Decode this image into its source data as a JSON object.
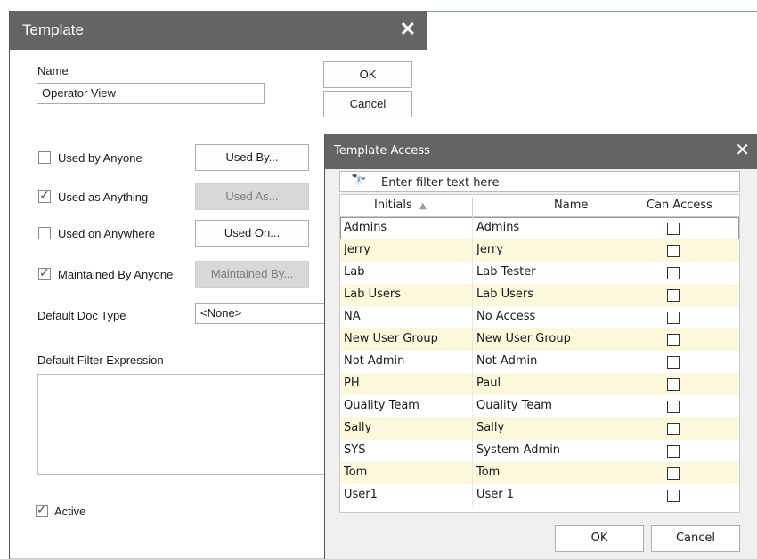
{
  "template_dialog": {
    "title": "Template",
    "name_label": "Name",
    "name_value": "Operator View",
    "ok_label": "OK",
    "cancel_label": "Cancel",
    "used_by_anyone_label": "Used by Anyone",
    "used_by_button": "Used By...",
    "used_as_anything_label": "Used as Anything",
    "used_as_button": "Used As...",
    "used_on_anywhere_label": "Used on Anywhere",
    "used_on_button": "Used On...",
    "maintained_by_anyone_label": "Maintained By Anyone",
    "maintained_by_button": "Maintained By...",
    "default_doc_type_label": "Default Doc Type",
    "default_doc_type_value": "<None>",
    "default_filter_label": "Default Filter Expression",
    "active_label": "Active"
  },
  "access_dialog": {
    "title": "Template Access",
    "filter_placeholder": "Enter filter text here",
    "columns": {
      "initials": "Initials",
      "sort_glyph": "▲",
      "name": "Name",
      "can_access": "Can Access"
    },
    "rows": [
      {
        "initials": "Admins",
        "name": "Admins"
      },
      {
        "initials": "Jerry",
        "name": "Jerry"
      },
      {
        "initials": "Lab",
        "name": "Lab Tester"
      },
      {
        "initials": "Lab Users",
        "name": "Lab Users"
      },
      {
        "initials": "NA",
        "name": "No Access"
      },
      {
        "initials": "New User Group",
        "name": "New User Group"
      },
      {
        "initials": "Not Admin",
        "name": "Not Admin"
      },
      {
        "initials": "PH",
        "name": "Paul"
      },
      {
        "initials": "Quality Team",
        "name": "Quality Team"
      },
      {
        "initials": "Sally",
        "name": "Sally"
      },
      {
        "initials": "SYS",
        "name": "System Admin"
      },
      {
        "initials": "Tom",
        "name": "Tom"
      },
      {
        "initials": "User1",
        "name": "User 1"
      }
    ],
    "ok_label": "OK",
    "cancel_label": "Cancel"
  },
  "colors": {
    "titlebar": "#646464",
    "row_alt": "#fbf8dc",
    "row_normal": "#ffffff"
  }
}
